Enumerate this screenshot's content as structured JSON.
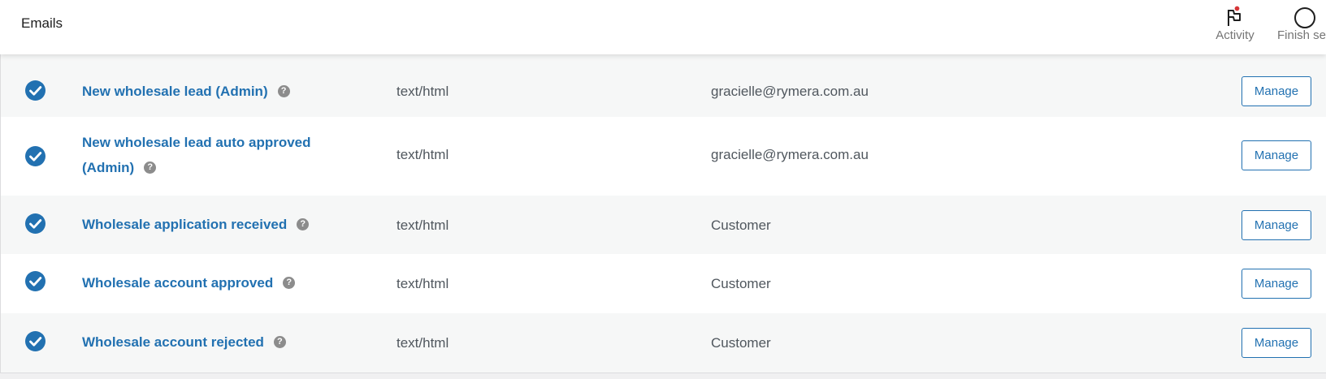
{
  "header": {
    "title": "Emails",
    "actions": [
      {
        "label": "Activity",
        "icon": "flag-icon",
        "has_notification": true,
        "notification_color": "#d63638"
      },
      {
        "label": "Finish se",
        "icon": "circle-progress-icon"
      }
    ]
  },
  "colors": {
    "accent": "#2271b1",
    "status_enabled": "#2271b1",
    "row_alt_bg": "#f6f7f7"
  },
  "emails": [
    {
      "name": "New wholesale lead (Admin)",
      "content_type": "text/html",
      "recipient": "gracielle@rymera.com.au",
      "enabled": true,
      "status_icon": "check-circle-icon",
      "help_icon": "question-icon",
      "help_glyph": "?",
      "action_label": "Manage"
    },
    {
      "name": "New wholesale lead auto approved (Admin)",
      "content_type": "text/html",
      "recipient": "gracielle@rymera.com.au",
      "enabled": true,
      "status_icon": "check-circle-icon",
      "help_icon": "question-icon",
      "help_glyph": "?",
      "action_label": "Manage"
    },
    {
      "name": "Wholesale application received",
      "content_type": "text/html",
      "recipient": "Customer",
      "enabled": true,
      "status_icon": "check-circle-icon",
      "help_icon": "question-icon",
      "help_glyph": "?",
      "action_label": "Manage"
    },
    {
      "name": "Wholesale account approved",
      "content_type": "text/html",
      "recipient": "Customer",
      "enabled": true,
      "status_icon": "check-circle-icon",
      "help_icon": "question-icon",
      "help_glyph": "?",
      "action_label": "Manage"
    },
    {
      "name": "Wholesale account rejected",
      "content_type": "text/html",
      "recipient": "Customer",
      "enabled": true,
      "status_icon": "check-circle-icon",
      "help_icon": "question-icon",
      "help_glyph": "?",
      "action_label": "Manage"
    }
  ]
}
